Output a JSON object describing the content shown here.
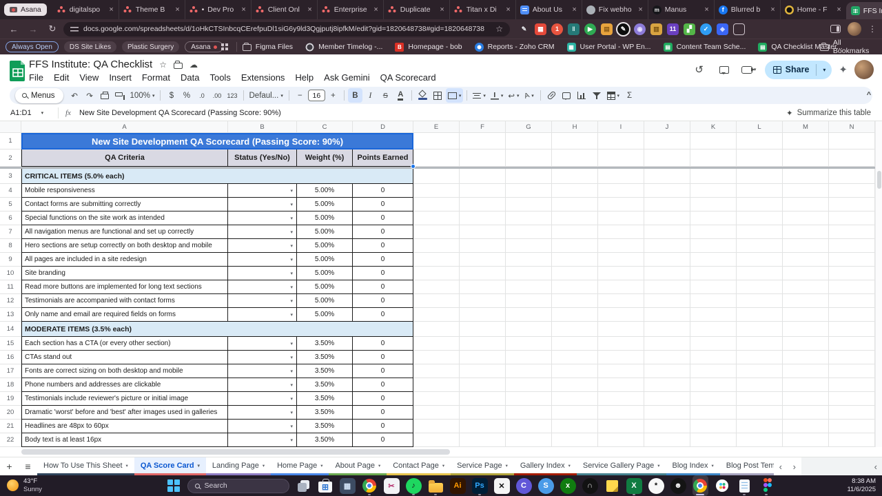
{
  "icons": {
    "sparkle": "✦",
    "star": "☆",
    "cloud": "☁",
    "caret": "▾",
    "kebab": "⋮",
    "back": "←",
    "forward": "→",
    "refresh": "↻",
    "new_tab": "+",
    "min": "—",
    "max": "▢",
    "close": "×",
    "hamburger": "≡",
    "chev_left": "‹",
    "chev_right": "›",
    "history": "↺",
    "plus": "+",
    "minus": "−",
    "collapse": "^",
    "fx": "fx",
    "sigma": "Σ",
    "undo": "↶",
    "redo": "↷",
    "wrap": "↩",
    "bold": "B",
    "italic": "I",
    "strike": "S",
    "color_a": "A",
    "rotate_a": "A",
    "dollar": "$",
    "percent": "%",
    "dec0": ".0",
    "dec00": ".00",
    "n123": "123"
  },
  "browser": {
    "tab_group": "Asana",
    "tabs": [
      {
        "label": "digitalspo",
        "icon": "asana"
      },
      {
        "label": "Theme B",
        "icon": "asana"
      },
      {
        "label": "Dev Pro",
        "icon": "asana",
        "dot": true
      },
      {
        "label": "Client Onl",
        "icon": "asana"
      },
      {
        "label": "Enterprise",
        "icon": "asana"
      },
      {
        "label": "Duplicate",
        "icon": "asana"
      },
      {
        "label": "Titan x Di",
        "icon": "asana"
      },
      {
        "label": "About Us",
        "icon": "doc-blue"
      },
      {
        "label": "Fix webho",
        "icon": "globe-gray"
      },
      {
        "label": "Manus",
        "icon": "manus-dark",
        "glyph": "m"
      },
      {
        "label": "Blurred b",
        "icon": "facebook-blue",
        "glyph": "f"
      },
      {
        "label": "Home - F",
        "icon": "round-dark-yellow"
      },
      {
        "label": "FFS Instit",
        "icon": "sheets-green",
        "active": true
      }
    ],
    "url": "docs.google.com/spreadsheets/d/1oHkCTSInbcqCErefpuDl1siG6y9ld3Qgjputj8ipfkM/edit?gid=1820648738#gid=1820648738",
    "extensions": [
      {
        "name": "pen-extension",
        "glyph": "✎",
        "fg": "#e8eaed",
        "bg": "transparent"
      },
      {
        "name": "red-grid-extension",
        "bg": "#e5493a",
        "glyph": "▦",
        "fg": "#ffffff"
      },
      {
        "name": "badge-one-extension",
        "bg": "#e8543f",
        "glyph": "1",
        "fg": "#ffffff",
        "circle": true
      },
      {
        "name": "teal-bar-extension",
        "bg": "#257a78",
        "glyph": "‖",
        "fg": "#d6f2ef"
      },
      {
        "name": "green-play-extension",
        "bg": "#2faa53",
        "glyph": "▶",
        "fg": "#ffffff",
        "circle": true
      },
      {
        "name": "amber-folder-extension",
        "bg": "#e8a33d",
        "glyph": "▤",
        "fg": "#8a5a16"
      },
      {
        "name": "pen-circle-extension",
        "bg": "#0d0d0d",
        "glyph": "✎",
        "fg": "#ffffff",
        "circle": true,
        "ring": true
      },
      {
        "name": "purple-orb-extension",
        "bg": "#8d7bd8",
        "glyph": "◉",
        "fg": "#e8e2ff",
        "circle": true
      },
      {
        "name": "tan-folder-extension",
        "bg": "#d9a441",
        "glyph": "▥",
        "fg": "#7a5312"
      },
      {
        "name": "purple-badge-11-extension",
        "bg": "#6a3fc0",
        "glyph": "11",
        "fg": "#ffffff"
      },
      {
        "name": "green-vine-extension",
        "bg": "#54b648",
        "glyph": "▞",
        "fg": "#ffffff"
      },
      {
        "name": "blue-check-extension",
        "bg": "#2f9df4",
        "glyph": "✓",
        "fg": "#ffffff",
        "circle": true
      },
      {
        "name": "blue-gem-extension",
        "bg": "#3a66f5",
        "glyph": "◆",
        "fg": "#cdd9ff"
      },
      {
        "name": "clipboard-extension",
        "outline": true,
        "glyph": "",
        "fg": "#e8eaed"
      }
    ]
  },
  "bookmarks": {
    "chips": [
      {
        "label": "Always Open",
        "style": "blue"
      },
      {
        "label": "DS Site Likes"
      },
      {
        "label": "Plastic Surgery"
      },
      {
        "label": "Asana",
        "style": "outline",
        "dot": true
      }
    ],
    "items": [
      {
        "label": "Figma Files",
        "icon": "folder"
      },
      {
        "label": "Member Timelog -...",
        "icon": "clock-dark"
      },
      {
        "label": "Homepage - bob",
        "icon": "b-red",
        "glyph": "B"
      },
      {
        "label": "Reports - Zoho CRM",
        "icon": "ring-blue"
      },
      {
        "label": "User Portal - WP En...",
        "icon": "grid-teal",
        "glyph": "▦"
      },
      {
        "label": "Content Team Sche...",
        "icon": "sheet-green",
        "glyph": "▤"
      },
      {
        "label": "QA Checklist Master...",
        "icon": "sheet-green",
        "glyph": "▤"
      }
    ],
    "all_bookmarks": "All Bookmarks"
  },
  "sheets": {
    "title": "FFS Institute: QA Checklist",
    "menu": [
      "File",
      "Edit",
      "View",
      "Insert",
      "Format",
      "Data",
      "Tools",
      "Extensions",
      "Help",
      "Ask Gemini",
      "QA Scorecard"
    ],
    "share_label": "Share",
    "toolbar": {
      "menus_label": "Menus",
      "zoom": "100%",
      "font": "Defaul...",
      "font_size": "16"
    },
    "formula_bar": {
      "cell_ref": "A1:D1",
      "value": "New Site Development QA Scorecard (Passing Score: 90%)"
    },
    "summarize_label": "Summarize this table"
  },
  "grid": {
    "columns": [
      "A",
      "B",
      "C",
      "D",
      "E",
      "F",
      "G",
      "H",
      "I",
      "J",
      "K",
      "L",
      "M",
      "N"
    ],
    "banner": "New Site Development QA Scorecard (Passing Score: 90%)",
    "headers": [
      "QA Criteria",
      "Status (Yes/No)",
      "Weight (%)",
      "Points Earned"
    ],
    "sections": [
      {
        "label": "CRITICAL ITEMS (5.0% each)",
        "weight": "5.00%",
        "points": "0",
        "items": [
          "Mobile responsiveness",
          "Contact forms are submitting correctly",
          "Special functions on the site work as intended",
          "All navigation menus are functional and set up correctly",
          "Hero sections are setup correctly on both desktop and mobile",
          "All pages are included in a site redesign",
          "Site branding",
          "Read more buttons are implemented for long text sections",
          "Testimonials are accompanied with contact forms",
          "Only name and email are required fields on forms"
        ]
      },
      {
        "label": "MODERATE ITEMS (3.5% each)",
        "weight": "3.50%",
        "points": "0",
        "items": [
          "Each section has a CTA (or every other section)",
          "CTAs stand out",
          "Fonts are correct sizing on both desktop and mobile",
          "Phone numbers and addresses are clickable",
          "Testimonials include reviewer's picture or initial image",
          "Dramatic 'worst' before and 'best' after images used in galleries",
          "Headlines are 48px to 60px",
          "Body text is at least 16px"
        ]
      }
    ]
  },
  "sheet_tabs": {
    "tabs": [
      {
        "label": "How To Use This Sheet",
        "color": "#30455c"
      },
      {
        "label": "QA Score Card",
        "color": "#e06666",
        "active": true
      },
      {
        "label": "Landing Page",
        "color": "#8e7cc3"
      },
      {
        "label": "Home Page",
        "color": "#4a86e8"
      },
      {
        "label": "About Page",
        "color": "#6aa84f"
      },
      {
        "label": "Contact Page",
        "color": "#e6c34d"
      },
      {
        "label": "Service Page",
        "color": "#b1a33b"
      },
      {
        "label": "Gallery Index",
        "color": "#a61c00"
      },
      {
        "label": "Service Gallery Page",
        "color": "#45818e"
      },
      {
        "label": "Blog Index",
        "color": "#3d85c6"
      },
      {
        "label": "Blog Post Tem",
        "color": "#a6a2bd",
        "truncated": true
      }
    ]
  },
  "taskbar": {
    "weather_temp": "43°F",
    "weather_cond": "Sunny",
    "search_label": "Search",
    "clock_time": "8:38 AM",
    "clock_date": "11/6/2025",
    "icons": [
      {
        "name": "task-view",
        "shape": "taskview"
      },
      {
        "name": "microsoft-store",
        "shape": "store",
        "glyph": "⊞"
      },
      {
        "name": "calculator-app",
        "bg": "#3d4c63",
        "glyph": "▦",
        "fg": "#cfe0f5"
      },
      {
        "name": "chrome",
        "shape": "chrome",
        "dot": true
      },
      {
        "name": "snipping-tool",
        "bg": "#f2f2f5",
        "glyph": "✂",
        "fg": "#b6336f"
      },
      {
        "name": "spotify",
        "bg": "#1ed760",
        "glyph": "♪",
        "fg": "#121212",
        "circle": true,
        "dot": true
      },
      {
        "name": "file-explorer",
        "shape": "folder",
        "dot": true
      },
      {
        "name": "adobe-illustrator",
        "bg": "#321500",
        "glyph": "Ai",
        "fg": "#ff9a00"
      },
      {
        "name": "adobe-photoshop",
        "bg": "#001e36",
        "glyph": "Ps",
        "fg": "#31a8ff",
        "dot": true
      },
      {
        "name": "capcut",
        "bg": "#f5f5f5",
        "glyph": "✕",
        "fg": "#111111"
      },
      {
        "name": "c-round-app",
        "bg": "#6157d8",
        "glyph": "C",
        "fg": "#ffffff",
        "circle": true
      },
      {
        "name": "s-round-app",
        "bg": "#4a9be8",
        "glyph": "S",
        "fg": "#ffffff",
        "circle": true
      },
      {
        "name": "xbox",
        "bg": "#107c10",
        "glyph": "x",
        "fg": "#ffffff",
        "circle": true
      },
      {
        "name": "wave-round-app",
        "bg": "#121212",
        "glyph": "∩",
        "fg": "#e8e8e8",
        "circle": true
      },
      {
        "name": "sticky-notes",
        "shape": "sticky"
      },
      {
        "name": "excel",
        "bg": "#107c41",
        "glyph": "X",
        "fg": "#ffffff",
        "dot": true
      },
      {
        "name": "chatgpt",
        "bg": "#f7f7f8",
        "glyph": "*",
        "fg": "#0d0d0d",
        "circle": true
      },
      {
        "name": "chat-face-app",
        "bg": "#141414",
        "glyph": "☻",
        "fg": "#f2f2f2",
        "circle": true
      },
      {
        "name": "chrome-active",
        "shape": "chrome",
        "active": true
      },
      {
        "name": "slack",
        "shape": "slack"
      },
      {
        "name": "notepad",
        "shape": "notepad",
        "dot": true
      },
      {
        "name": "figma",
        "shape": "figma",
        "dot": true
      }
    ]
  }
}
